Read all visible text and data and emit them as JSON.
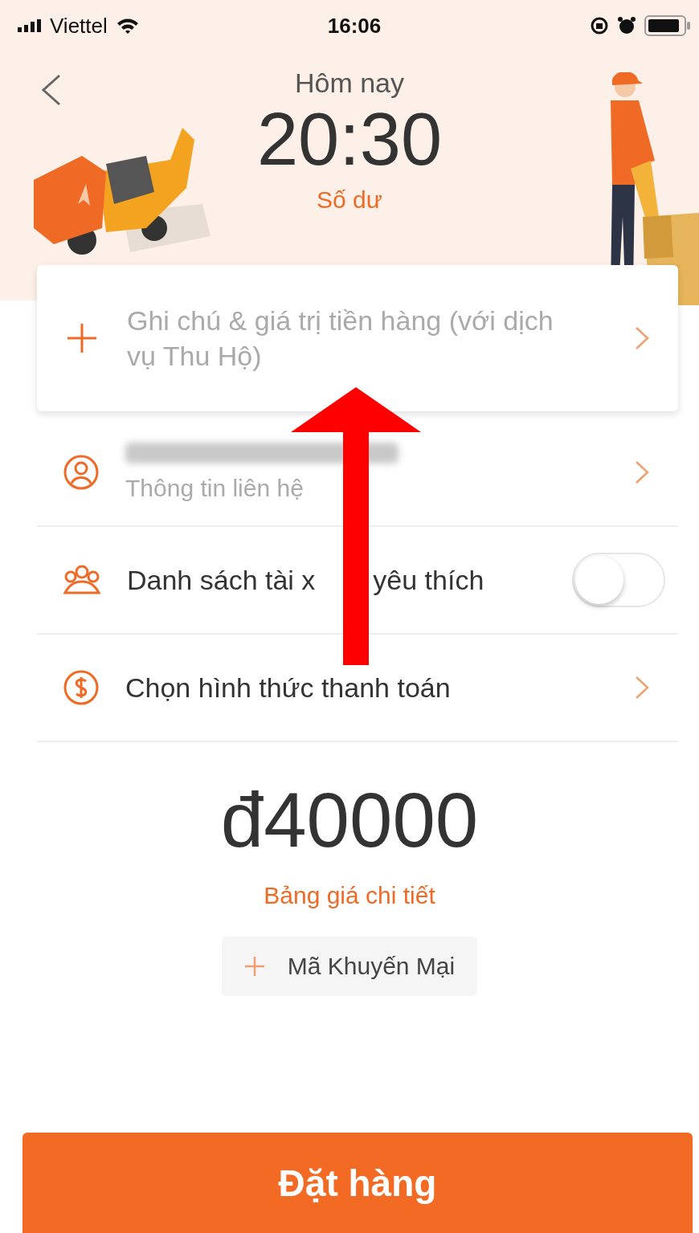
{
  "status_bar": {
    "carrier": "Viettel",
    "time": "16:06"
  },
  "header": {
    "title": "Hôm nay",
    "time": "20:30",
    "balance_link": "Số dư"
  },
  "note_card": {
    "placeholder": "Ghi chú & giá trị tiền hàng (với dịch vụ Thu Hộ)"
  },
  "rows": [
    {
      "kind": "contact",
      "label": "Thông tin liên hệ"
    },
    {
      "kind": "toggle",
      "label": "Danh sách tài x",
      "label_after_arrow": "yêu thích",
      "on": false
    },
    {
      "kind": "payment",
      "label": "Chọn hình thức thanh toán"
    }
  ],
  "price": "đ40000",
  "price_link": "Bảng giá chi tiết",
  "promo_button": "Mã Khuyến Mại",
  "order_button": "Đặt hàng"
}
